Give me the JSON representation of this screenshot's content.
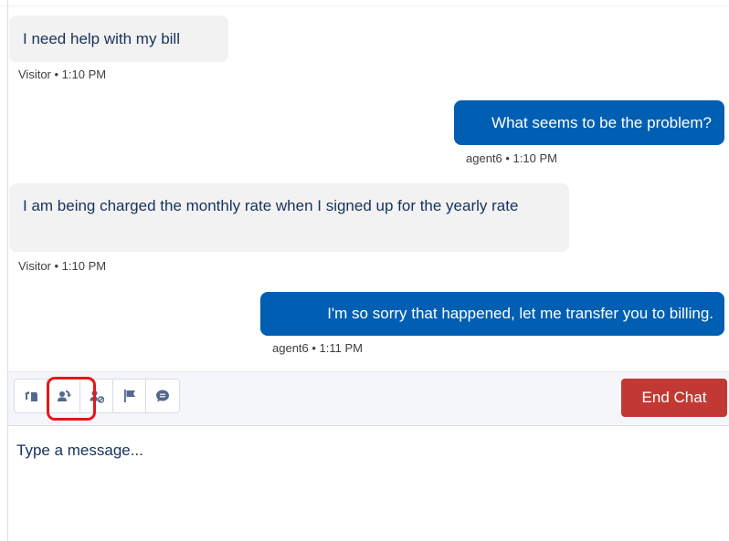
{
  "messages": [
    {
      "sender": "Visitor",
      "text": "I need help with my bill",
      "meta": "Visitor • 1:10 PM"
    },
    {
      "sender": "agent6",
      "text": "What seems to be the problem?",
      "meta": "agent6 • 1:10 PM"
    },
    {
      "sender": "Visitor",
      "text": "I am being charged the monthly rate when I signed up for the yearly rate",
      "meta": "Visitor • 1:10 PM"
    },
    {
      "sender": "agent6",
      "text": "I'm so sorry that happened, let me transfer you to billing.",
      "meta": "agent6 • 1:11 PM"
    }
  ],
  "toolbar": {
    "tools": [
      {
        "icon": "attach-file-icon"
      },
      {
        "icon": "transfer-user-icon",
        "highlighted": true
      },
      {
        "icon": "block-user-icon"
      },
      {
        "icon": "flag-icon"
      },
      {
        "icon": "chat-bubble-icon"
      }
    ],
    "end_chat_label": "End Chat"
  },
  "composer": {
    "placeholder": "Type a message..."
  },
  "colors": {
    "agent_bubble": "#005fb2",
    "visitor_bubble": "#f3f2f2",
    "end_chat": "#c23934",
    "highlight": "#e0191b"
  }
}
